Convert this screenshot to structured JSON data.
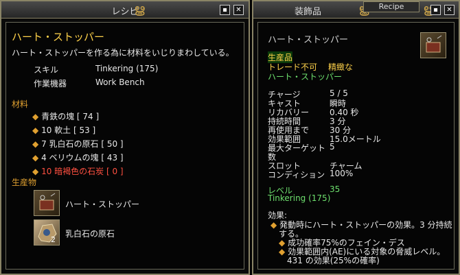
{
  "recipe_window": {
    "title": "レシピ",
    "item_name": "ハート・ストッパー",
    "description": "ハート・ストッパーを作る為に材料をいじりまわしている。",
    "skill_label": "スキル",
    "skill_value": "Tinkering (175)",
    "station_label": "作業機器",
    "station_value": "Work Bench",
    "materials_header": "材料",
    "materials": [
      "青鉄の塊 [ 74 ]",
      "10 軟土 [ 53 ]",
      "7 乳白石の原石 [ 50 ]",
      "4 ベリウムの塊 [ 43 ]",
      "10 暗褐色の石炭 [ 0 ]"
    ],
    "products_header": "生産物",
    "products": [
      {
        "name": "ハート・ストッパー",
        "count": ""
      },
      {
        "name": "乳白石の原石",
        "count": "2"
      }
    ]
  },
  "item_window": {
    "title": "装飾品",
    "tab_label": "Recipe",
    "item_name": "ハート・ストッパー",
    "tag_crafted": "生産品",
    "tag_notrade": "トレード不可",
    "tag_quality": "精緻な",
    "tag_name": "ハート・ストッパー",
    "stats": [
      {
        "label": "チャージ",
        "value": "5 / 5"
      },
      {
        "label": "キャスト",
        "value": "瞬時"
      },
      {
        "label": "リカバリー",
        "value": "0.40 秒"
      },
      {
        "label": "持続時間",
        "value": "3 分"
      },
      {
        "label": "再使用まで",
        "value": "30 分"
      },
      {
        "label": "効果範囲",
        "value": "15.0メートル"
      },
      {
        "label": "最大ターゲット",
        "value": "5"
      },
      {
        "label": "数",
        "value": ""
      },
      {
        "label": "スロット",
        "value": "チャーム"
      },
      {
        "label": "コンディション",
        "value": "100%"
      }
    ],
    "level_label": "レベル",
    "level_value": "35",
    "skill_req": "Tinkering (175)",
    "effects_header": "効果:",
    "effect_line1": "発動時にハート・ストッパーの効果。3 分持続",
    "effect_line2": "する。",
    "effect_sub1": "成功確率75%のフェイン・デス",
    "effect_sub2": "効果範囲内(AE)にいる対象の脅威レベル。",
    "effect_sub3": "431 の効果(25%の確率)"
  },
  "icons": {
    "minimize": "minimize-icon",
    "close": "close-icon",
    "swirl": "swirl-icon"
  }
}
